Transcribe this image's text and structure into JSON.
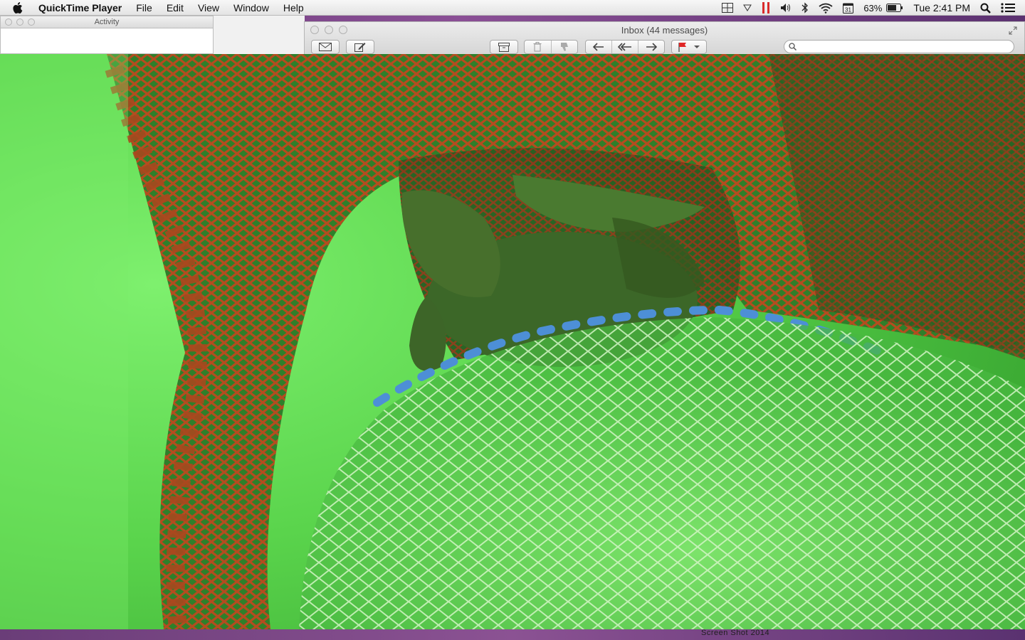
{
  "menubar": {
    "app_name": "QuickTime Player",
    "items": [
      "File",
      "Edit",
      "View",
      "Window",
      "Help"
    ],
    "battery_percent": "63%",
    "clock": "Tue 2:41 PM"
  },
  "activity_window": {
    "title": "Activity"
  },
  "mail_window": {
    "title": "Inbox (44 messages)",
    "search_placeholder": ""
  },
  "video": {
    "colors": {
      "water": "#5fdc52",
      "net_brown": "#b04a1e",
      "net_light": "#c8f0c0",
      "rope_blue": "#4a8fd8",
      "turtle": "#3f6a2a"
    }
  },
  "bottom_partial_text": "Screen Shot 2014"
}
